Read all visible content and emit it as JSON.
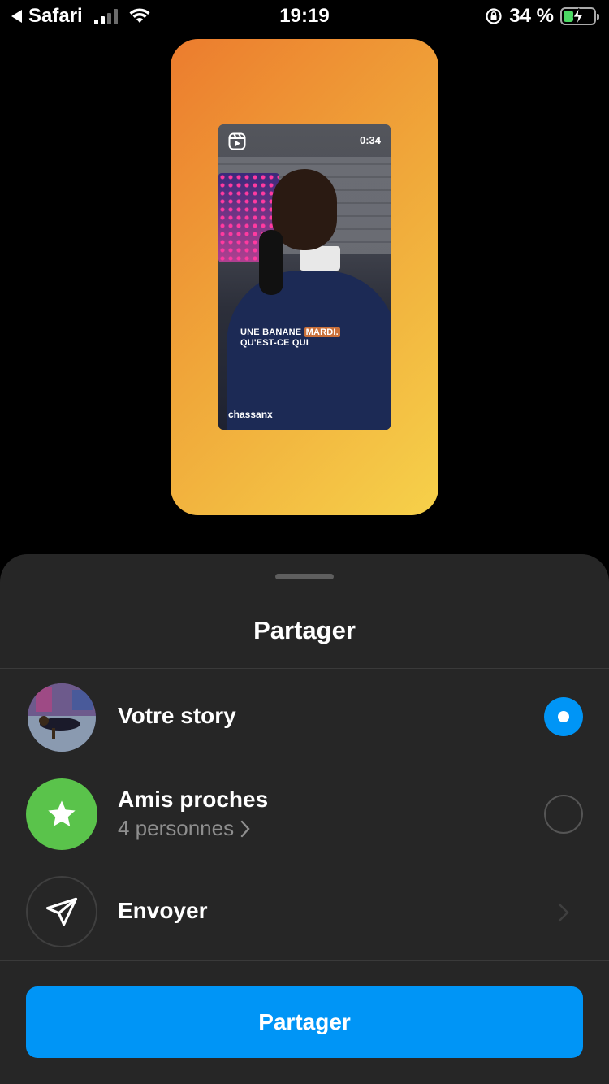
{
  "status_bar": {
    "back_app": "Safari",
    "time": "19:19",
    "battery_percent": "34 %",
    "battery_level": 0.34,
    "icons": [
      "back-arrow-icon",
      "signal-icon",
      "wifi-icon",
      "orientation-lock-icon",
      "battery-charging-icon"
    ]
  },
  "preview": {
    "duration": "0:34",
    "caption_line1": "UNE BANANE",
    "caption_highlight": "MARDI.",
    "caption_line2": "QU'EST-CE QUI",
    "username": "chassanx",
    "gradient_colors": [
      "#ec7c2e",
      "#f6d14a"
    ]
  },
  "sheet": {
    "title": "Partager",
    "options": [
      {
        "label": "Votre story",
        "selected": true
      },
      {
        "label": "Amis proches",
        "sub": "4 personnes",
        "selected": false
      },
      {
        "label": "Envoyer"
      }
    ],
    "button_label": "Partager"
  },
  "colors": {
    "accent": "#0095f6",
    "close_friends": "#5ac34b",
    "sheet_bg": "#262626"
  }
}
